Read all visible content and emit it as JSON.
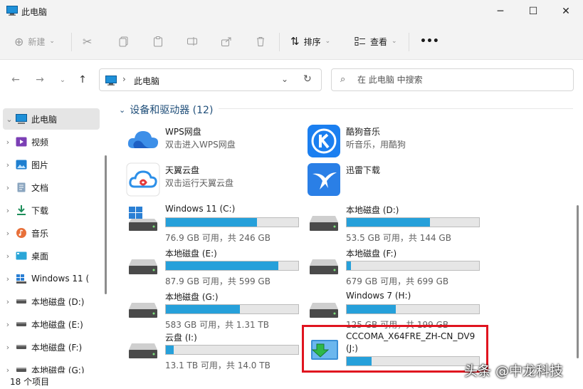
{
  "window": {
    "title": "此电脑"
  },
  "toolbar": {
    "new_label": "新建",
    "sort_label": "排序",
    "view_label": "查看",
    "more_label": "•••"
  },
  "address": {
    "path": "此电脑"
  },
  "search": {
    "placeholder": "在 此电脑 中搜索"
  },
  "sidebar": {
    "items": [
      {
        "label": "此电脑",
        "icon": "computer-icon"
      },
      {
        "label": "视频",
        "icon": "video-icon"
      },
      {
        "label": "图片",
        "icon": "picture-icon"
      },
      {
        "label": "文档",
        "icon": "document-icon"
      },
      {
        "label": "下载",
        "icon": "download-icon"
      },
      {
        "label": "音乐",
        "icon": "music-icon"
      },
      {
        "label": "桌面",
        "icon": "desktop-icon"
      },
      {
        "label": "Windows 11 (",
        "icon": "windows-drive-icon"
      },
      {
        "label": "本地磁盘 (D:)",
        "icon": "drive-icon"
      },
      {
        "label": "本地磁盘 (E:)",
        "icon": "drive-icon"
      },
      {
        "label": "本地磁盘 (F:)",
        "icon": "drive-icon"
      },
      {
        "label": "本地磁盘 (G:)",
        "icon": "drive-icon"
      }
    ]
  },
  "group": {
    "title": "设备和驱动器 (12)"
  },
  "apps": [
    {
      "name": "WPS网盘",
      "sub": "双击进入WPS网盘",
      "icon": "wps-cloud-icon"
    },
    {
      "name": "酷狗音乐",
      "sub": "听音乐，用酷狗",
      "icon": "kugou-icon"
    },
    {
      "name": "天翼云盘",
      "sub": "双击运行天翼云盘",
      "icon": "tianyi-cloud-icon"
    },
    {
      "name": "迅雷下载",
      "sub": "",
      "icon": "thunder-icon"
    }
  ],
  "drives": [
    {
      "name": "Windows 11 (C:)",
      "sub": "76.9 GB 可用，共 246 GB",
      "used": 0.69
    },
    {
      "name": "本地磁盘 (D:)",
      "sub": "53.5 GB 可用，共 144 GB",
      "used": 0.63
    },
    {
      "name": "本地磁盘 (E:)",
      "sub": "87.9 GB 可用，共 599 GB",
      "used": 0.85
    },
    {
      "name": "本地磁盘 (F:)",
      "sub": "679 GB 可用，共 699 GB",
      "used": 0.03
    },
    {
      "name": "本地磁盘 (G:)",
      "sub": "583 GB 可用，共 1.31 TB",
      "used": 0.56
    },
    {
      "name": "Windows 7 (H:)",
      "sub": "125 GB 可用，共 199 GB",
      "used": 0.37
    },
    {
      "name": "云盘 (I:)",
      "sub": "13.1 TB 可用，共 14.0 TB",
      "used": 0.06
    },
    {
      "name": "CCCOMA_X64FRE_ZH-CN_DV9",
      "sub": "(J:)",
      "used": 0.19
    }
  ],
  "status": {
    "count": "18 个项目"
  },
  "watermark": {
    "text": "头条 @中龙科技"
  },
  "colors": {
    "accent": "#26a0da",
    "highlight": "#e0141f"
  }
}
